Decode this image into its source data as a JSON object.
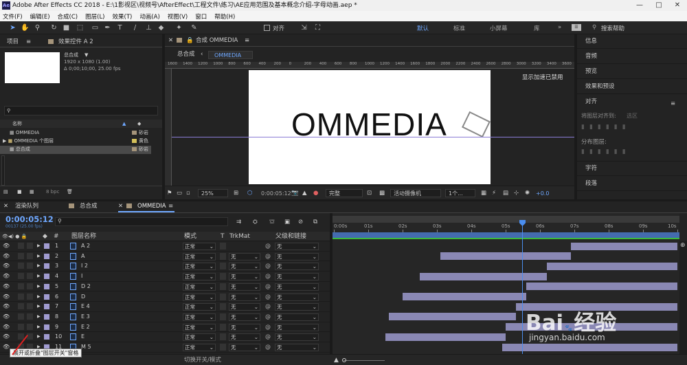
{
  "window": {
    "title": "Adobe After Effects CC 2018 - E:\\1影视区\\视频号\\AfterEffect\\工程文件\\练习\\AE应用范围及基本概念介绍-字母动画.aep *",
    "icon": "Ae"
  },
  "menu": [
    "文件(F)",
    "编辑(E)",
    "合成(C)",
    "图层(L)",
    "效果(T)",
    "动画(A)",
    "视图(V)",
    "窗口",
    "帮助(H)"
  ],
  "toolbar": {
    "align_label": "对齐",
    "workspaces": [
      "默认",
      "标准",
      "小屏幕",
      "库"
    ],
    "search_placeholder": "搜索帮助"
  },
  "project": {
    "tab_project": "项目",
    "tab_effects": "效果控件 A 2",
    "comp_name": "总合成",
    "comp_size": "1920 x 1080 (1.00)",
    "comp_duration": "Δ 0;00;10;00, 25.00 fps",
    "col_name": "名称",
    "items": [
      {
        "name": "OMMEDIA",
        "label": "砂岩"
      },
      {
        "name": "OMMEDIA 个图层",
        "label": "黄色"
      },
      {
        "name": "总合成",
        "label": "砂岩"
      }
    ],
    "bpc": "8 bpc",
    "colors": {
      "sand": "#a5947a",
      "yellow": "#d4c05a"
    }
  },
  "comp_panel": {
    "tab_title": "合成 OMMEDIA",
    "breadcrumbs": [
      "总合成",
      "OMMEDIA"
    ],
    "overlay": "显示加速已禁用",
    "canvas_text": "OMMEDIA",
    "zoom": "25%",
    "timecode": "0:00:05:12",
    "quality": "完整",
    "camera": "活动摄像机",
    "views": "1个...",
    "exposure": "+0.0",
    "ruler_labels": [
      "1600",
      "1400",
      "1200",
      "1000",
      "800",
      "600",
      "400",
      "200",
      "0",
      "200",
      "400",
      "600",
      "800",
      "1000",
      "1200",
      "1400",
      "1600",
      "1800",
      "2000",
      "2200",
      "2400",
      "2600",
      "2800",
      "3000",
      "3200",
      "3400",
      "3600"
    ]
  },
  "right_panel": {
    "items": [
      "信息",
      "音频",
      "预览",
      "效果和预设"
    ],
    "align_title": "对齐",
    "align_to_label": "将图层对齐到:",
    "align_to_value": "选区",
    "distribute_label": "分布图层:",
    "items_bottom": [
      "字符",
      "段落"
    ]
  },
  "timeline": {
    "tabs": [
      "渲染队列",
      "总合成",
      "OMMEDIA"
    ],
    "timecode": "0:00:05:12",
    "timecode_sub": "00137 (25.00 fps)",
    "search_placeholder": "",
    "columns": {
      "num": "#",
      "name": "图层名称",
      "mode": "模式",
      "t": "T",
      "trkmat": "TrkMat",
      "parent": "父级和链接"
    },
    "ruler": [
      "0:00s",
      "01s",
      "02s",
      "03s",
      "04s",
      "05s",
      "06s",
      "07s",
      "08s",
      "09s",
      "10s"
    ],
    "playhead_sec": 5.48,
    "layers": [
      {
        "num": "1",
        "name": "A 2",
        "mode": "正常",
        "trk": "",
        "parent": "无",
        "start": 6.9,
        "end": 10
      },
      {
        "num": "2",
        "name": "A",
        "mode": "正常",
        "trk": "无",
        "parent": "无",
        "start": 3.1,
        "end": 6.9
      },
      {
        "num": "3",
        "name": "I 2",
        "mode": "正常",
        "trk": "无",
        "parent": "无",
        "start": 6.2,
        "end": 10
      },
      {
        "num": "4",
        "name": "I",
        "mode": "正常",
        "trk": "无",
        "parent": "无",
        "start": 2.5,
        "end": 6.2
      },
      {
        "num": "5",
        "name": "D 2",
        "mode": "正常",
        "trk": "无",
        "parent": "无",
        "start": 5.6,
        "end": 10
      },
      {
        "num": "6",
        "name": "D",
        "mode": "正常",
        "trk": "无",
        "parent": "无",
        "start": 2.0,
        "end": 5.6
      },
      {
        "num": "7",
        "name": "E 4",
        "mode": "正常",
        "trk": "无",
        "parent": "无",
        "start": 5.3,
        "end": 10
      },
      {
        "num": "8",
        "name": "E 3",
        "mode": "正常",
        "trk": "无",
        "parent": "无",
        "start": 1.6,
        "end": 5.3
      },
      {
        "num": "9",
        "name": "E 2",
        "mode": "正常",
        "trk": "无",
        "parent": "无",
        "start": 5.0,
        "end": 10
      },
      {
        "num": "10",
        "name": "E",
        "mode": "正常",
        "trk": "无",
        "parent": "无",
        "start": 1.5,
        "end": 5.0
      },
      {
        "num": "11",
        "name": "M 5",
        "mode": "正常",
        "trk": "无",
        "parent": "无",
        "start": 4.9,
        "end": 10
      }
    ],
    "tooltip": "展开或折叠\"图层开关\"窗格",
    "bottom_label": "切换开关/模式"
  },
  "watermark": {
    "brand": "Bai",
    "brand2": "经验",
    "url": "jingyan.baidu.com"
  }
}
